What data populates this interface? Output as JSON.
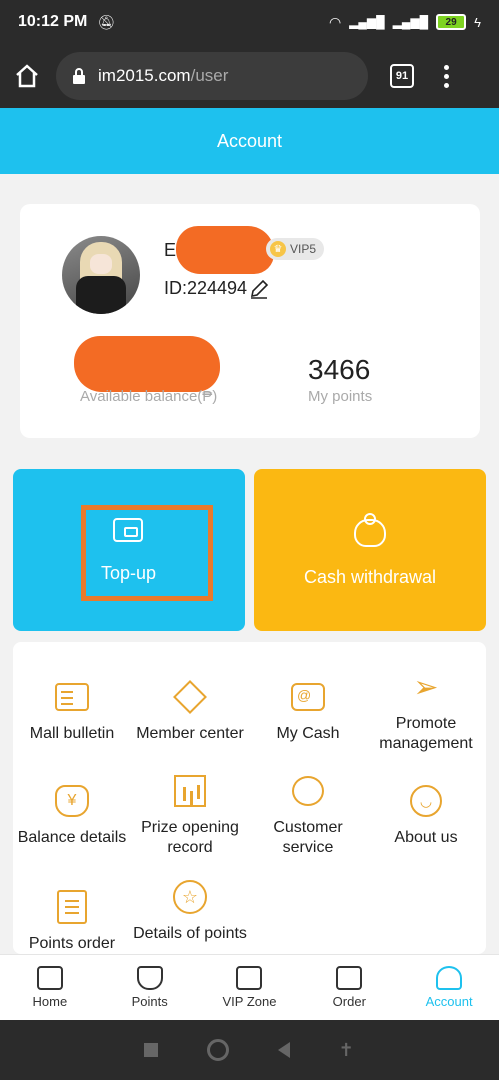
{
  "status_bar": {
    "time": "10:12 PM",
    "battery": "29"
  },
  "browser": {
    "domain": "im2015.com",
    "path": "/user",
    "tab_count": "91"
  },
  "header": {
    "title": "Account"
  },
  "profile": {
    "username_initial": "E",
    "vip_label": "VIP5",
    "user_id": "ID:224494",
    "balance_label": "Available balance(₱)",
    "points_value": "3466",
    "points_label": "My points"
  },
  "actions": {
    "topup_label": "Top-up",
    "withdraw_label": "Cash withdrawal"
  },
  "menu": {
    "items": [
      {
        "label": "Mall bulletin",
        "icon": "bulletin-icon"
      },
      {
        "label": "Member center",
        "icon": "diamond-icon"
      },
      {
        "label": "My Cash",
        "icon": "wallet-icon"
      },
      {
        "label": "Promote management",
        "icon": "paper-plane-icon"
      },
      {
        "label": "Balance details",
        "icon": "money-bag-icon"
      },
      {
        "label": "Prize opening record",
        "icon": "chart-icon"
      },
      {
        "label": "Customer service",
        "icon": "chat-bubble-icon"
      },
      {
        "label": "About us",
        "icon": "smile-icon"
      },
      {
        "label": "Points order",
        "icon": "clipboard-icon"
      },
      {
        "label": "Details of points",
        "icon": "star-icon"
      }
    ]
  },
  "bottom_nav": {
    "items": [
      {
        "label": "Home"
      },
      {
        "label": "Points"
      },
      {
        "label": "VIP Zone"
      },
      {
        "label": "Order"
      },
      {
        "label": "Account"
      }
    ]
  },
  "colors": {
    "accent": "#1ec1ee",
    "withdraw": "#fbb812",
    "icon": "#e8a52f",
    "highlight": "#e97a2b",
    "redaction": "#f36b24"
  }
}
